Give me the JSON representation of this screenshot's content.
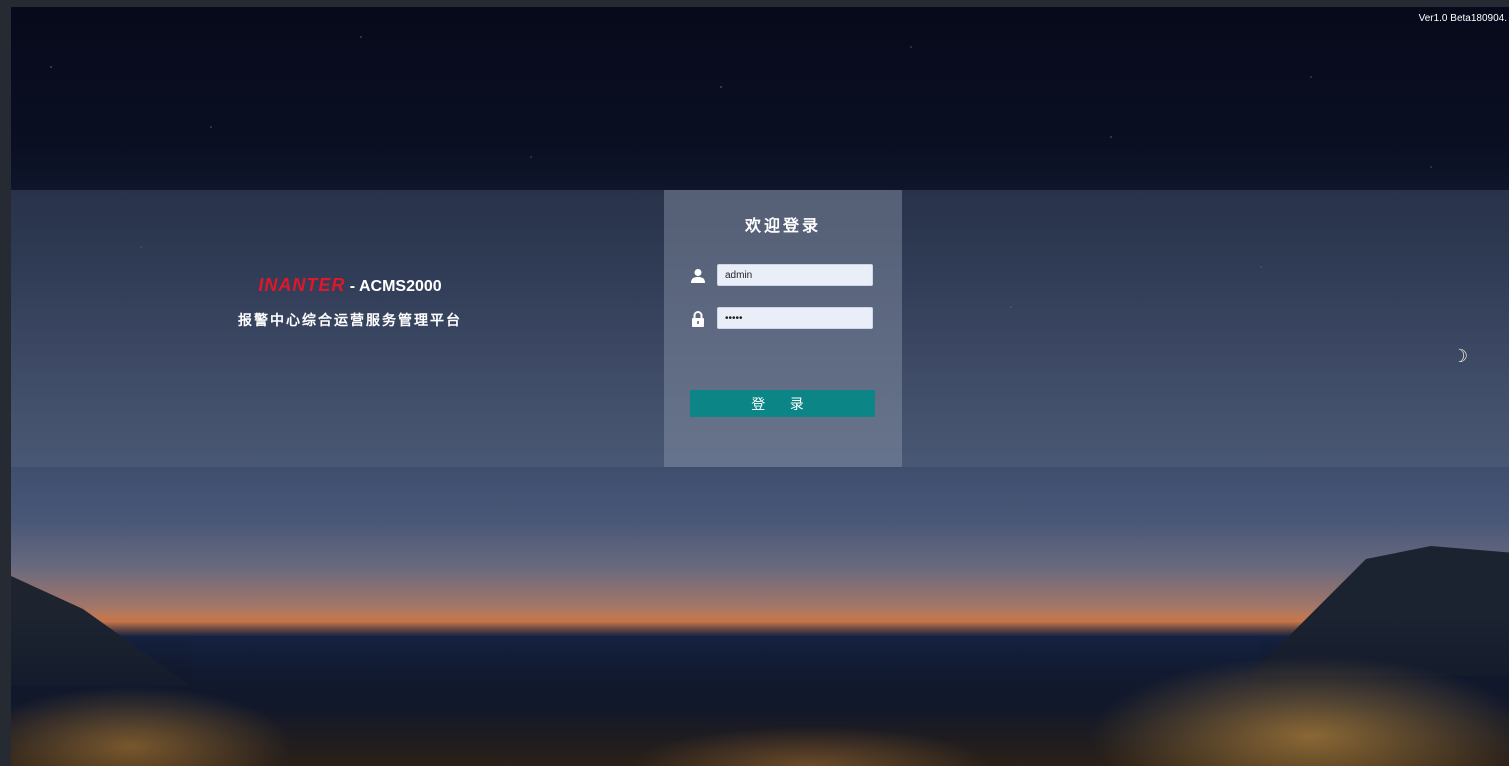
{
  "header": {
    "version": "Ver1.0 Beta180904."
  },
  "brand": {
    "logo_text": "INANTER",
    "product_suffix": " - ACMS2000",
    "subtitle": "报警中心综合运营服务管理平台",
    "logo_color": "#e0172a"
  },
  "login": {
    "title": "欢迎登录",
    "username_value": "admin",
    "password_value": "•••••",
    "submit_label": "登 录",
    "button_color": "#0b8585"
  },
  "icons": {
    "username": "user-icon",
    "password": "lock-icon",
    "moon": "moon-icon"
  }
}
